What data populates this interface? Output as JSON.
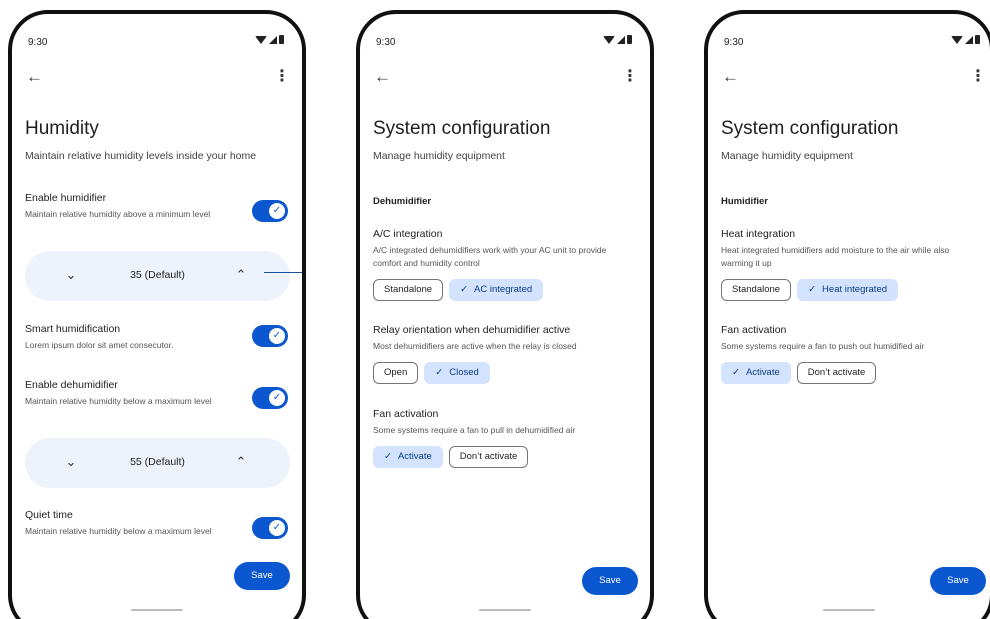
{
  "status": {
    "time": "9:30"
  },
  "icons": {
    "back": "←",
    "more": "⋮",
    "check": "✓",
    "chevron_down": "⌄",
    "chevron_up": "⌃"
  },
  "colors": {
    "accent": "#0b57d0",
    "chip_selected": "#d3e3fd",
    "stepper_bg": "#edf2fb"
  },
  "humidity": {
    "title": "Humidity",
    "subtitle": "Maintain relative humidity levels inside your home",
    "enable_humidifier": {
      "title": "Enable humidifier",
      "desc": "Maintain relative humidity above a minimum level",
      "on": true
    },
    "humidifier_stepper": {
      "value": "35 (Default)"
    },
    "smart": {
      "title": "Smart humidification",
      "desc": "Lorem ipsum dolor sit amet consecutor.",
      "on": true
    },
    "enable_dehumidifier": {
      "title": "Enable dehumidifier",
      "desc": "Maintain relative humidity below a maximum level",
      "on": true
    },
    "dehumidifier_stepper": {
      "value": "55 (Default)"
    },
    "quiet": {
      "title": "Quiet time",
      "desc": "Maintain relative humidity below a maximum level",
      "on": true
    },
    "save_label": "Save"
  },
  "dehumidifier_config": {
    "title": "System configuration",
    "subtitle": "Manage humidity equipment",
    "section": "Dehumidifier",
    "ac": {
      "title": "A/C integration",
      "desc": "A/C integrated dehumidifiers work with your AC unit to provide comfort and humidity control",
      "options": [
        "Standalone",
        "AC integrated"
      ],
      "selected": "AC integrated"
    },
    "relay": {
      "title": "Relay orientation when dehumidifier active",
      "desc": "Most dehumidifiers are active when the relay is closed",
      "options": [
        "Open",
        "Closed"
      ],
      "selected": "Closed"
    },
    "fan": {
      "title": "Fan activation",
      "desc": "Some systems require a fan to pull in dehumidified air",
      "options": [
        "Activate",
        "Don’t activate"
      ],
      "selected": "Activate"
    },
    "save_label": "Save"
  },
  "humidifier_config": {
    "title": "System configuration",
    "subtitle": "Manage humidity equipment",
    "section": "Humidifier",
    "heat": {
      "title": "Heat integration",
      "desc": "Heat integrated humidifiers add moisture to the air while also warming it up",
      "options": [
        "Standalone",
        "Heat integrated"
      ],
      "selected": "Heat integrated"
    },
    "fan": {
      "title": "Fan activation",
      "desc": "Some systems require a fan to push out humidified air",
      "options": [
        "Activate",
        "Don’t activate"
      ],
      "selected": "Activate"
    },
    "save_label": "Save"
  }
}
